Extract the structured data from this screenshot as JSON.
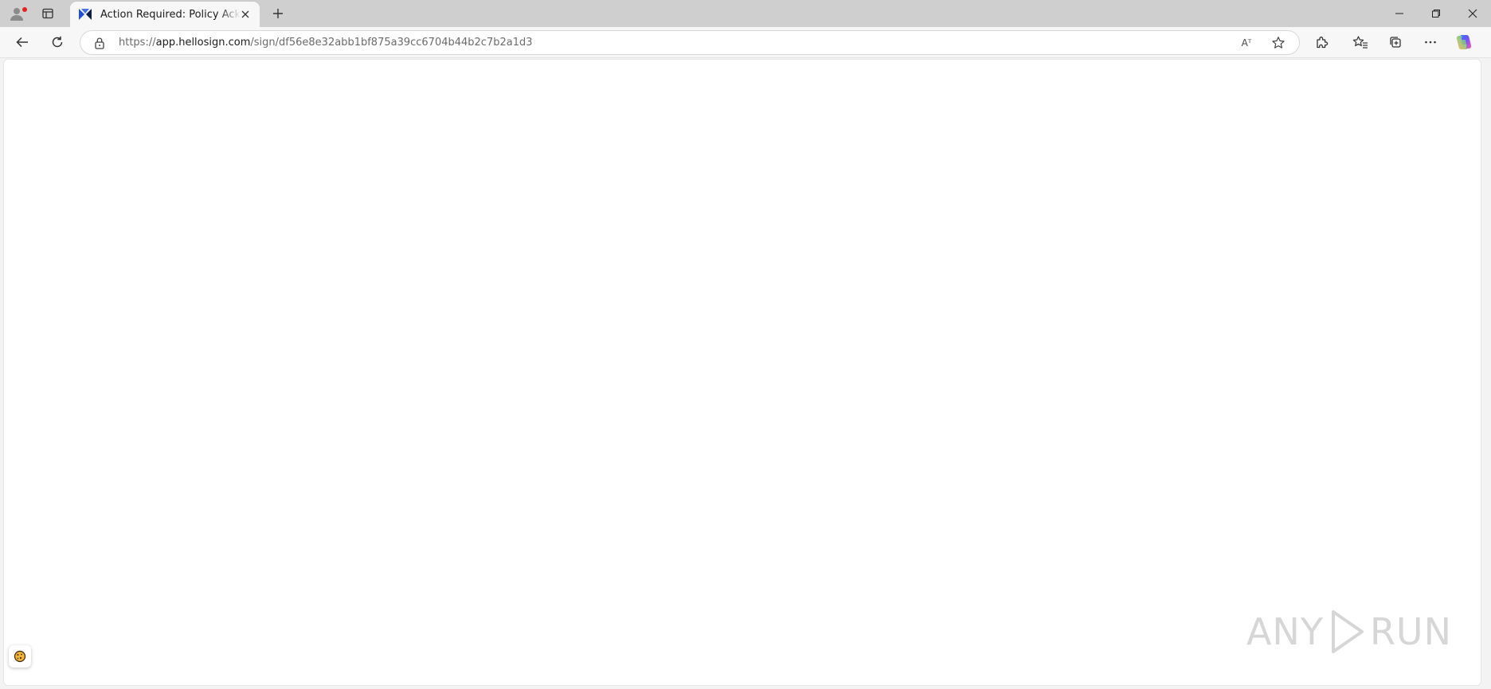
{
  "browser": {
    "tab": {
      "title": "Action Required: Policy Acknowledgement",
      "favicon": "hellosign-logo-icon"
    },
    "address": {
      "scheme": "https://",
      "host": "app.hellosign.com",
      "path": "/sign/df56e8e32abb1bf875a39cc6704b44b2c7b2a1d3"
    },
    "read_aloud_label": "Aᵀ"
  },
  "watermark": {
    "left": "ANY",
    "right": "RUN"
  },
  "colors": {
    "tabstrip": "#cfcfcf",
    "toolbar": "#f7f7f7",
    "content": "#ffffff",
    "accent_blue": "#1a4fe0",
    "profile_dot": "#e0241d"
  }
}
